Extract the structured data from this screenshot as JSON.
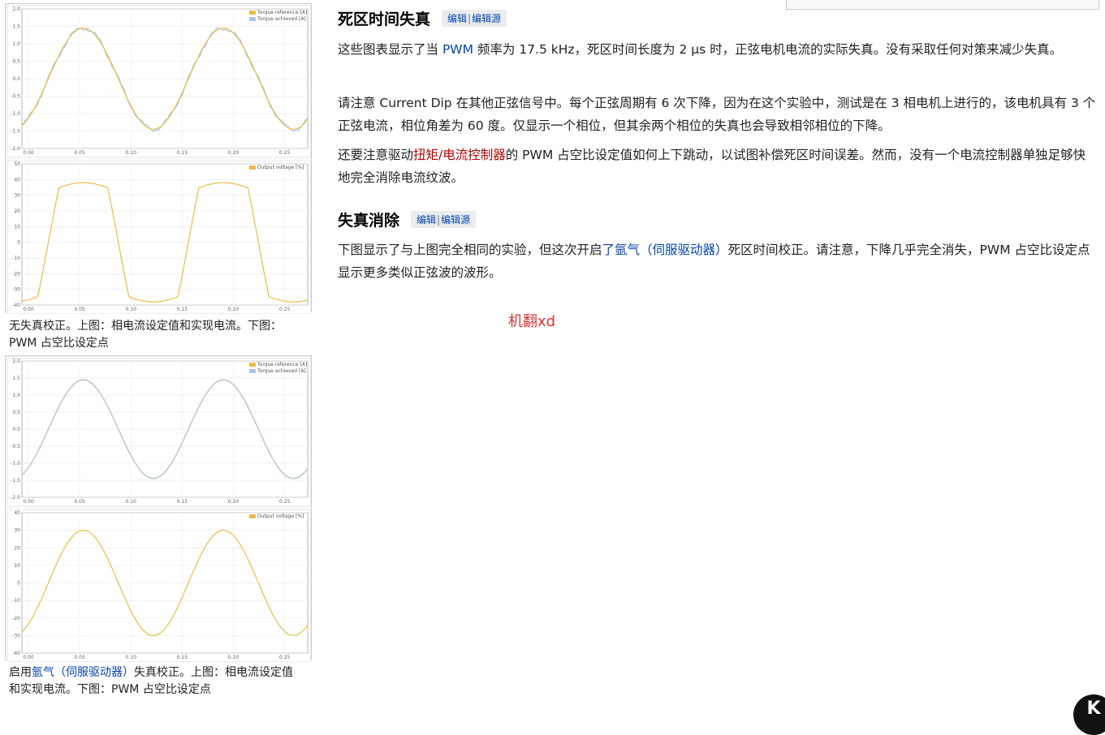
{
  "figures": [
    {
      "id": "fig-no-correction",
      "caption": "无失真校正。上图：相电流设定值和实现电流。下图：PWM 占空比设定点",
      "top_chart": {
        "series": [
          {
            "name": "Torque reference [A]",
            "color": "#e8bd4a"
          },
          {
            "name": "Torque achieved [A]",
            "color": "#a9c5e6"
          }
        ],
        "y_ticks": [
          "2.0",
          "1.5",
          "1.0",
          "0.5",
          "0.0",
          "-0.5",
          "-1.0",
          "-1.5",
          "-2.0"
        ],
        "x_ticks": [
          "0.00",
          "0.05",
          "0.10",
          "0.15",
          "0.20",
          "0.25"
        ]
      },
      "bottom_chart": {
        "series": [
          {
            "name": "Output voltage [%]",
            "color": "#e8bd4a"
          }
        ],
        "y_ticks": [
          "50",
          "40",
          "30",
          "20",
          "10",
          "0",
          "-10",
          "-20",
          "-30",
          "-40"
        ],
        "x_ticks": [
          "0.00",
          "0.05",
          "0.10",
          "0.15",
          "0.20",
          "0.25"
        ]
      }
    },
    {
      "id": "fig-with-correction",
      "caption_prefix": "启用",
      "caption_link": "氩气（伺服驱动器）",
      "caption_suffix": "失真校正。上图：相电流设定值和实现电流。下图：PWM 占空比设定点",
      "top_chart": {
        "series": [
          {
            "name": "Torque reference [A]",
            "color": "#e8bd4a"
          },
          {
            "name": "Torque achieved [A]",
            "color": "#a9c5e6"
          }
        ],
        "y_ticks": [
          "2.0",
          "1.5",
          "1.0",
          "0.5",
          "0.0",
          "-0.5",
          "-1.0",
          "-1.5",
          "-2.0"
        ],
        "x_ticks": [
          "0.00",
          "0.05",
          "0.10",
          "0.15",
          "0.20",
          "0.25"
        ]
      },
      "bottom_chart": {
        "series": [
          {
            "name": "Output voltage [%]",
            "color": "#e8bd4a"
          }
        ],
        "y_ticks": [
          "40",
          "30",
          "20",
          "10",
          "0",
          "-10",
          "-20",
          "-30",
          "-40"
        ],
        "x_ticks": [
          "0.00",
          "0.05",
          "0.10",
          "0.15",
          "0.20",
          "0.25"
        ]
      }
    }
  ],
  "section1": {
    "heading": "死区时间失真",
    "edit": "编辑",
    "edit_source": "编辑源",
    "p1_a": "这些图表显示了当 ",
    "p1_link": "PWM",
    "p1_b": " 频率为 17.5 kHz，死区时间长度为 2 µs 时，正弦电机电流的实际失真。没有采取任何对策来减少失真。",
    "p2": "请注意 Current Dip 在其他正弦信号中。每个正弦周期有 6 次下降，因为在这个实验中，测试是在 3 相电机上进行的，该电机具有 3 个正弦电流，相位角差为 60 度。仅显示一个相位，但其余两个相位的失真也会导致相邻相位的下降。",
    "p3_a": "还要注意驱动",
    "p3_link": "扭矩/电流控制器",
    "p3_b": "的 PWM 占空比设定值如何上下跳动，以试图补偿死区时间误差。然而，没有一个电流控制器单独足够快地完全消除电流纹波。"
  },
  "section2": {
    "heading": "失真消除",
    "edit": "编辑",
    "edit_source": "编辑源",
    "p1_a": "下图显示了与上图完全相同的实验，但这次开启",
    "p1_link": "了氩气（伺服驱动器）",
    "p1_b": "死区时间校正。请注意，下降几乎完全消失，PWM 占空比设定点显示更多类似正弦波的波形。"
  },
  "machine_translation_note": "机翻xd",
  "corner_badge": "K"
}
